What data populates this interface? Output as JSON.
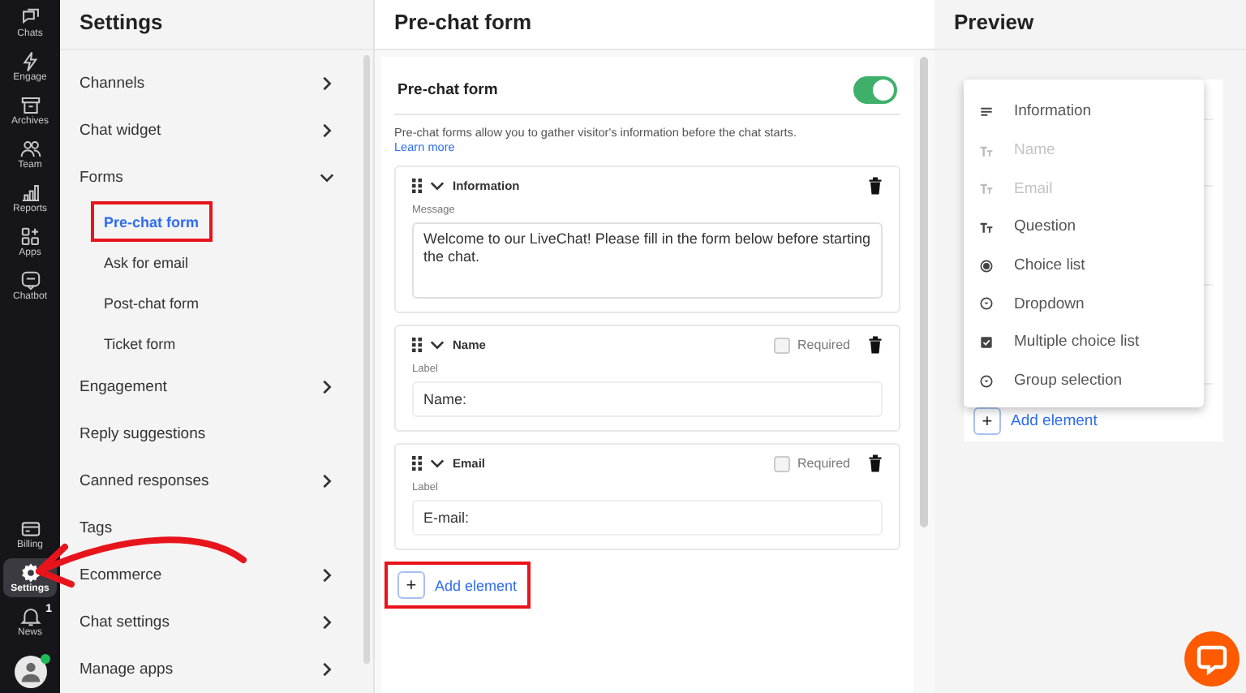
{
  "rail": {
    "top": [
      {
        "label": "Chats",
        "selected": false
      },
      {
        "label": "Engage",
        "selected": false
      },
      {
        "label": "Archives",
        "selected": false
      },
      {
        "label": "Team",
        "selected": false
      },
      {
        "label": "Reports",
        "selected": false
      },
      {
        "label": "Apps",
        "selected": false
      },
      {
        "label": "Chatbot",
        "selected": false
      }
    ],
    "bottom": [
      {
        "label": "Billing",
        "selected": false,
        "annotated": false
      },
      {
        "label": "Settings",
        "selected": true,
        "annotated": true
      },
      {
        "label": "News",
        "selected": false,
        "annotated": false,
        "badge": "1"
      }
    ],
    "avatar": {
      "online": true
    }
  },
  "settings": {
    "title": "Settings",
    "items": [
      {
        "label": "Channels",
        "expandable": true
      },
      {
        "label": "Chat widget",
        "expandable": true
      },
      {
        "label": "Forms",
        "expandable": true,
        "expanded": true,
        "children": [
          {
            "label": "Pre-chat form",
            "selected": true,
            "annotated": true
          },
          {
            "label": "Ask for email",
            "selected": false,
            "annotated": false
          },
          {
            "label": "Post-chat form",
            "selected": false,
            "annotated": false
          },
          {
            "label": "Ticket form",
            "selected": false,
            "annotated": false
          }
        ]
      },
      {
        "label": "Engagement",
        "expandable": true
      },
      {
        "label": "Reply suggestions",
        "expandable": false
      },
      {
        "label": "Canned responses",
        "expandable": true
      },
      {
        "label": "Tags",
        "expandable": false
      },
      {
        "label": "Ecommerce",
        "expandable": true
      },
      {
        "label": "Chat settings",
        "expandable": true
      },
      {
        "label": "Manage apps",
        "expandable": true
      }
    ]
  },
  "form_panel": {
    "title": "Pre-chat form",
    "section_title": "Pre-chat form",
    "enabled": true,
    "description": "Pre-chat forms allow you to gather visitor's information before the chat starts.",
    "learn_more": "Learn more",
    "elements": [
      {
        "kind": "information",
        "title": "Information",
        "field_label": "Message",
        "value": "Welcome to our LiveChat! Please fill in the form below before starting the chat."
      },
      {
        "kind": "text",
        "title": "Name",
        "required_label": "Required",
        "required": false,
        "field_label": "Label",
        "value": "Name:"
      },
      {
        "kind": "text",
        "title": "Email",
        "required_label": "Required",
        "required": false,
        "field_label": "Label",
        "value": "E-mail:"
      }
    ],
    "add_button": {
      "icon": "+",
      "label": "Add element",
      "annotated": true
    }
  },
  "preview": {
    "title": "Preview",
    "menu": [
      {
        "kind": "information",
        "label": "Information",
        "disabled": false
      },
      {
        "kind": "text",
        "label": "Name",
        "disabled": true
      },
      {
        "kind": "text",
        "label": "Email",
        "disabled": true
      },
      {
        "kind": "text",
        "label": "Question",
        "disabled": false
      },
      {
        "kind": "radio",
        "label": "Choice list",
        "disabled": false
      },
      {
        "kind": "dropdown",
        "label": "Dropdown",
        "disabled": false
      },
      {
        "kind": "checkbox",
        "label": "Multiple choice list",
        "disabled": false
      },
      {
        "kind": "dropdown",
        "label": "Group selection",
        "disabled": false
      }
    ],
    "add_button": {
      "icon": "+",
      "label": "Add element"
    }
  }
}
